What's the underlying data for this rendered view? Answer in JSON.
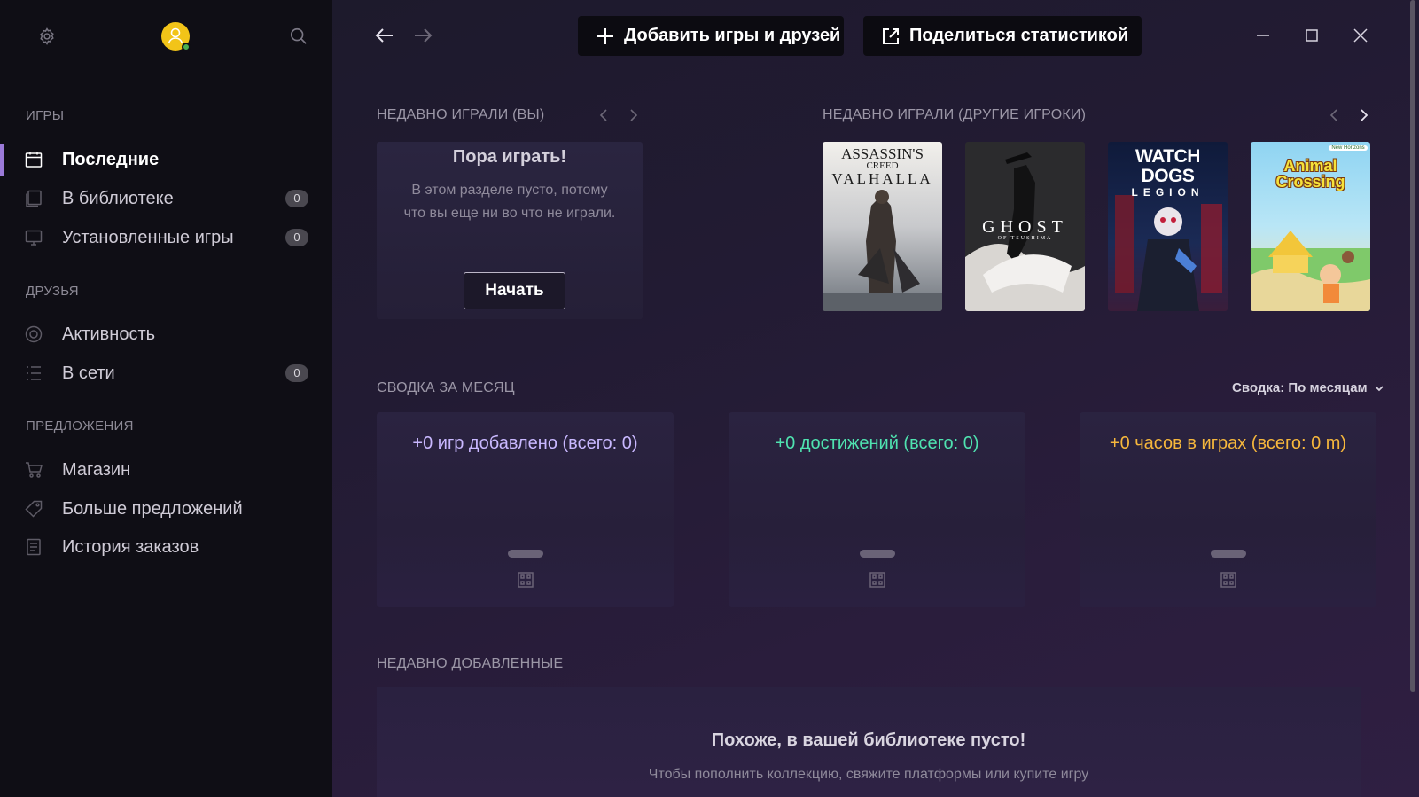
{
  "sidebar": {
    "sections": {
      "games": "ИГРЫ",
      "friends": "ДРУЗЬЯ",
      "offers": "ПРЕДЛОЖЕНИЯ"
    },
    "items": [
      {
        "label": "Последние",
        "icon": "calendar-icon"
      },
      {
        "label": "В библиотеке",
        "icon": "library-icon",
        "badge": "0"
      },
      {
        "label": "Установленные игры",
        "icon": "monitor-icon",
        "badge": "0"
      },
      {
        "label": "Активность",
        "icon": "activity-icon"
      },
      {
        "label": "В сети",
        "icon": "list-icon",
        "badge": "0"
      },
      {
        "label": "Магазин",
        "icon": "cart-icon"
      },
      {
        "label": "Больше предложений",
        "icon": "tag-icon"
      },
      {
        "label": "История заказов",
        "icon": "receipt-icon"
      }
    ]
  },
  "toolbar": {
    "add_label": "Добавить игры и друзей",
    "share_label": "Поделиться статистикой"
  },
  "recent_you": {
    "title": "НЕДАВНО ИГРАЛИ (ВЫ)",
    "card_title": "Пора играть!",
    "card_text": "В этом разделе пусто, потому что вы еще ни во что не играли.",
    "button": "Начать"
  },
  "recent_others": {
    "title": "НЕДАВНО ИГРАЛИ (ДРУГИЕ ИГРОКИ)",
    "covers": [
      {
        "line1": "ASSASSIN'S",
        "line2": "CREED",
        "line3": "VALHALLA"
      },
      {
        "line1": "GHOST",
        "line2": "OF TSUSHIMA"
      },
      {
        "line1": "WATCH DOGS",
        "line2": "LEGION"
      },
      {
        "line1": "Animal",
        "line2": "Crossing",
        "line3": "New Horizons"
      }
    ]
  },
  "summary": {
    "title": "СВОДКА ЗА МЕСЯЦ",
    "dropdown": "Сводка: По месяцам",
    "cards": [
      {
        "text": "+0 игр добавлено (всего: 0)",
        "color": "#c9b8ff"
      },
      {
        "text": "+0 достижений (всего: 0)",
        "color": "#4fe3b0"
      },
      {
        "text": "+0 часов в играх (всего: 0 m)",
        "color": "#f6b73c"
      }
    ]
  },
  "recently_added": {
    "title": "НЕДАВНО ДОБАВЛЕННЫЕ",
    "empty_title": "Похоже, в вашей библиотеке пусто!",
    "empty_text": "Чтобы пополнить коллекцию, свяжите платформы или купите игру"
  },
  "colors": {
    "accent": "#9b7ad8",
    "avatar": "#f2c418",
    "online": "#4caf50"
  }
}
